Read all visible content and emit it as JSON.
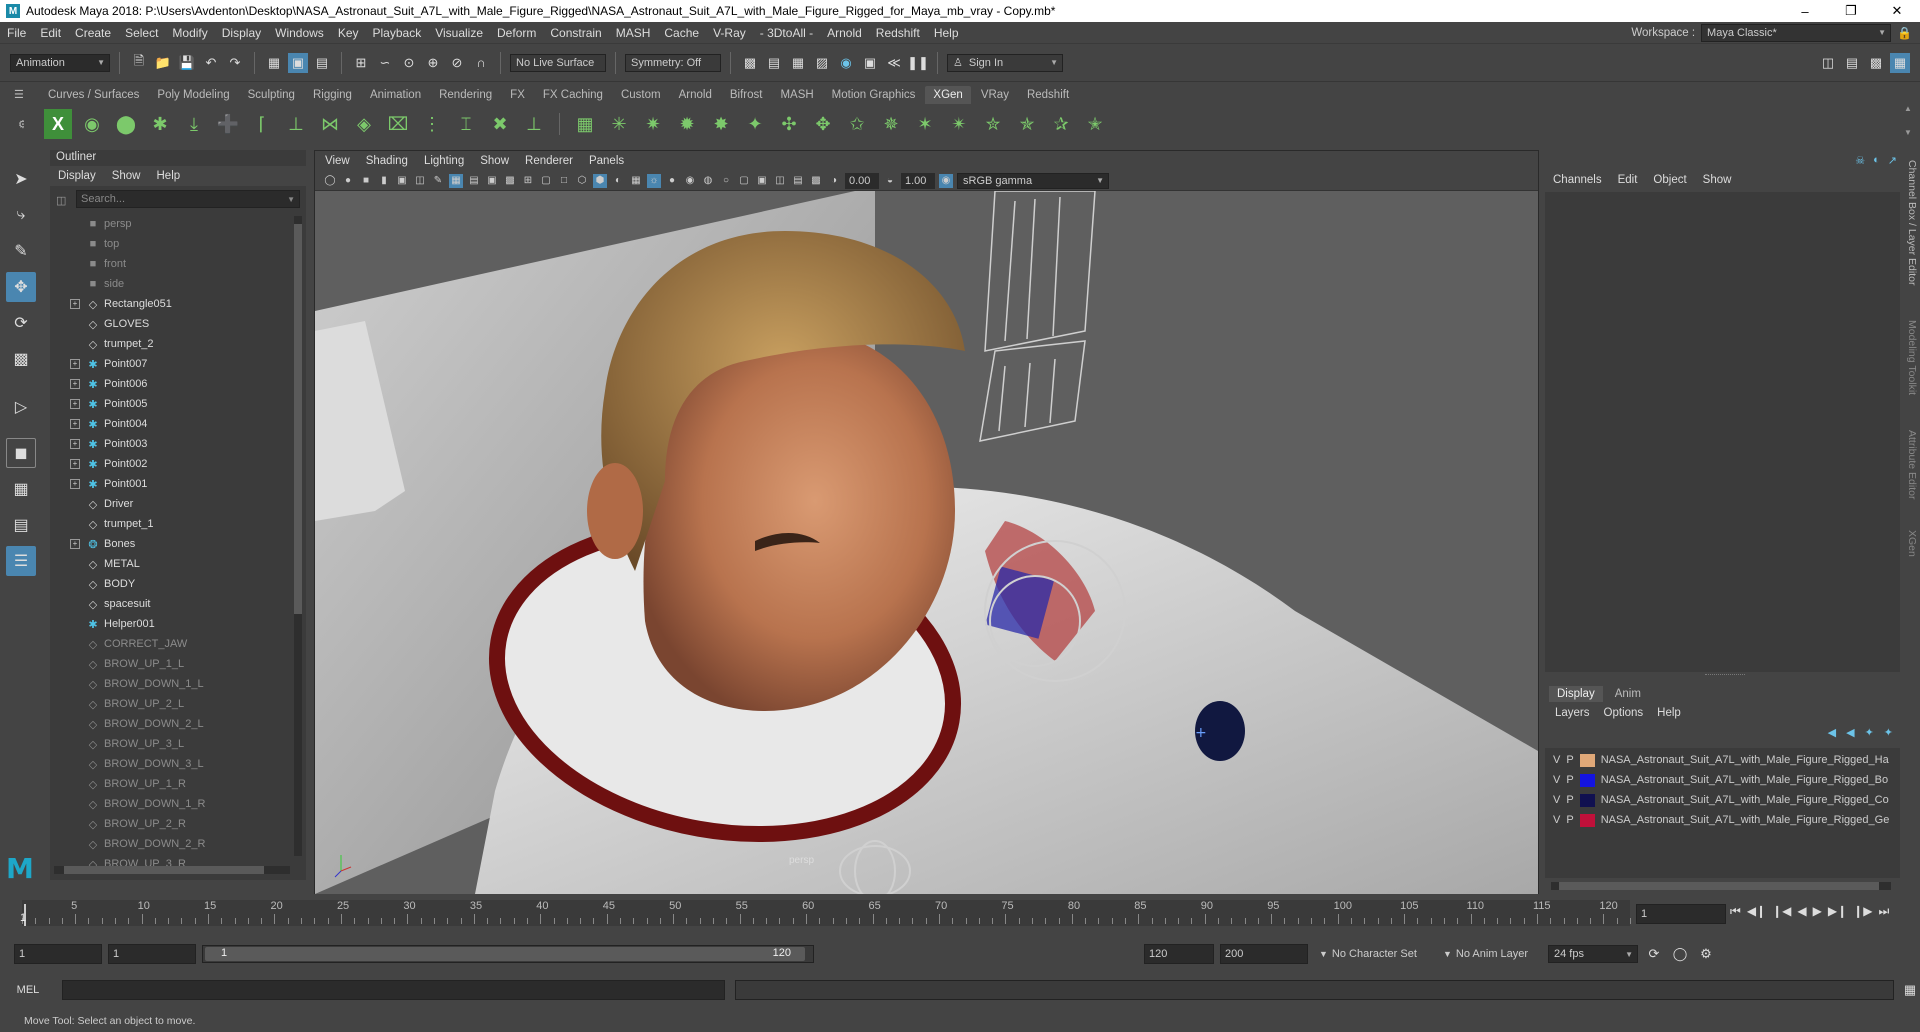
{
  "window": {
    "title": "Autodesk Maya 2018: P:\\Users\\Avdenton\\Desktop\\NASA_Astronaut_Suit_A7L_with_Male_Figure_Rigged\\NASA_Astronaut_Suit_A7L_with_Male_Figure_Rigged_for_Maya_mb_vray - Copy.mb*",
    "logo": "M"
  },
  "menu": [
    "File",
    "Edit",
    "Create",
    "Select",
    "Modify",
    "Display",
    "Windows",
    "Key",
    "Playback",
    "Visualize",
    "Deform",
    "Constrain",
    "MASH",
    "Cache",
    "V-Ray",
    "- 3DtoAll -",
    "Arnold",
    "Redshift",
    "Help"
  ],
  "workspace": {
    "label": "Workspace :",
    "value": "Maya Classic*"
  },
  "statusline": {
    "menuset": "Animation",
    "live_surface": "No Live Surface",
    "symmetry": "Symmetry: Off",
    "sign_in": "Sign In"
  },
  "shelf_tabs": [
    "Curves / Surfaces",
    "Poly Modeling",
    "Sculpting",
    "Rigging",
    "Animation",
    "Rendering",
    "FX",
    "FX Caching",
    "Custom",
    "Arnold",
    "Bifrost",
    "MASH",
    "Motion Graphics",
    "XGen",
    "VRay",
    "Redshift"
  ],
  "shelf_active": "XGen",
  "outliner": {
    "title": "Outliner",
    "menu": [
      "Display",
      "Show",
      "Help"
    ],
    "search_placeholder": "Search...",
    "items": [
      {
        "label": "persp",
        "icon": "camera",
        "dim": true,
        "exp": false
      },
      {
        "label": "top",
        "icon": "camera",
        "dim": true,
        "exp": false
      },
      {
        "label": "front",
        "icon": "camera",
        "dim": true,
        "exp": false
      },
      {
        "label": "side",
        "icon": "camera",
        "dim": true,
        "exp": false
      },
      {
        "label": "Rectangle051",
        "icon": "mesh",
        "dim": false,
        "exp": true
      },
      {
        "label": "GLOVES",
        "icon": "mesh",
        "dim": false,
        "exp": false
      },
      {
        "label": "trumpet_2",
        "icon": "mesh",
        "dim": false,
        "exp": false
      },
      {
        "label": "Point007",
        "icon": "locator",
        "dim": false,
        "exp": true
      },
      {
        "label": "Point006",
        "icon": "locator",
        "dim": false,
        "exp": true
      },
      {
        "label": "Point005",
        "icon": "locator",
        "dim": false,
        "exp": true
      },
      {
        "label": "Point004",
        "icon": "locator",
        "dim": false,
        "exp": true
      },
      {
        "label": "Point003",
        "icon": "locator",
        "dim": false,
        "exp": true
      },
      {
        "label": "Point002",
        "icon": "locator",
        "dim": false,
        "exp": true
      },
      {
        "label": "Point001",
        "icon": "locator",
        "dim": false,
        "exp": true
      },
      {
        "label": "Driver",
        "icon": "mesh",
        "dim": false,
        "exp": false
      },
      {
        "label": "trumpet_1",
        "icon": "mesh",
        "dim": false,
        "exp": false
      },
      {
        "label": "Bones",
        "icon": "joint",
        "dim": false,
        "exp": true
      },
      {
        "label": "METAL",
        "icon": "mesh",
        "dim": false,
        "exp": false
      },
      {
        "label": "BODY",
        "icon": "mesh",
        "dim": false,
        "exp": false
      },
      {
        "label": "spacesuit",
        "icon": "mesh",
        "dim": false,
        "exp": false
      },
      {
        "label": "Helper001",
        "icon": "locator",
        "dim": false,
        "exp": false
      },
      {
        "label": "CORRECT_JAW",
        "icon": "mesh",
        "dim": true,
        "exp": false
      },
      {
        "label": "BROW_UP_1_L",
        "icon": "mesh",
        "dim": true,
        "exp": false
      },
      {
        "label": "BROW_DOWN_1_L",
        "icon": "mesh",
        "dim": true,
        "exp": false
      },
      {
        "label": "BROW_UP_2_L",
        "icon": "mesh",
        "dim": true,
        "exp": false
      },
      {
        "label": "BROW_DOWN_2_L",
        "icon": "mesh",
        "dim": true,
        "exp": false
      },
      {
        "label": "BROW_UP_3_L",
        "icon": "mesh",
        "dim": true,
        "exp": false
      },
      {
        "label": "BROW_DOWN_3_L",
        "icon": "mesh",
        "dim": true,
        "exp": false
      },
      {
        "label": "BROW_UP_1_R",
        "icon": "mesh",
        "dim": true,
        "exp": false
      },
      {
        "label": "BROW_DOWN_1_R",
        "icon": "mesh",
        "dim": true,
        "exp": false
      },
      {
        "label": "BROW_UP_2_R",
        "icon": "mesh",
        "dim": true,
        "exp": false
      },
      {
        "label": "BROW_DOWN_2_R",
        "icon": "mesh",
        "dim": true,
        "exp": false
      },
      {
        "label": "BROW_UP_3_R",
        "icon": "mesh",
        "dim": true,
        "exp": false
      }
    ]
  },
  "viewport": {
    "menu": [
      "View",
      "Shading",
      "Lighting",
      "Show",
      "Renderer",
      "Panels"
    ],
    "exposure": "0.00",
    "gamma": "1.00",
    "color_space": "sRGB gamma",
    "camera_label": "persp"
  },
  "channel_box": {
    "menu": [
      "Channels",
      "Edit",
      "Object",
      "Show"
    ]
  },
  "layer_editor": {
    "tabs": [
      "Display",
      "Anim"
    ],
    "menu": [
      "Layers",
      "Options",
      "Help"
    ],
    "layers": [
      {
        "v": "V",
        "p": "P",
        "color": "#e0a878",
        "name": "NASA_Astronaut_Suit_A7L_with_Male_Figure_Rigged_Ha"
      },
      {
        "v": "V",
        "p": "P",
        "color": "#1414e0",
        "name": "NASA_Astronaut_Suit_A7L_with_Male_Figure_Rigged_Bo"
      },
      {
        "v": "V",
        "p": "P",
        "color": "#101050",
        "name": "NASA_Astronaut_Suit_A7L_with_Male_Figure_Rigged_Co"
      },
      {
        "v": "V",
        "p": "P",
        "color": "#c0103a",
        "name": "NASA_Astronaut_Suit_A7L_with_Male_Figure_Rigged_Ge"
      }
    ]
  },
  "side_tabs": [
    "Channel Box / Layer Editor",
    "Modeling Toolkit",
    "Attribute Editor",
    "XGen"
  ],
  "timeline": {
    "ticks": [
      "5",
      "10",
      "15",
      "20",
      "25",
      "30",
      "35",
      "40",
      "45",
      "50",
      "55",
      "60",
      "65",
      "70",
      "75",
      "80",
      "85",
      "90",
      "95",
      "100",
      "105",
      "110",
      "115",
      "120"
    ],
    "current_frame": "1",
    "current_frame_marker": "1"
  },
  "range": {
    "start": "1",
    "playback_start": "1",
    "slider_start": "1",
    "slider_end": "120",
    "playback_end": "120",
    "end": "200",
    "character_set": "No Character Set",
    "anim_layer": "No Anim Layer",
    "fps": "24 fps"
  },
  "command_line": {
    "label": "MEL"
  },
  "help_line": "Move Tool: Select an object to move.",
  "colors": {
    "accent": "#4a86b0",
    "shelf_icon": "#7cc96b",
    "joint": "#4fc3e6"
  }
}
